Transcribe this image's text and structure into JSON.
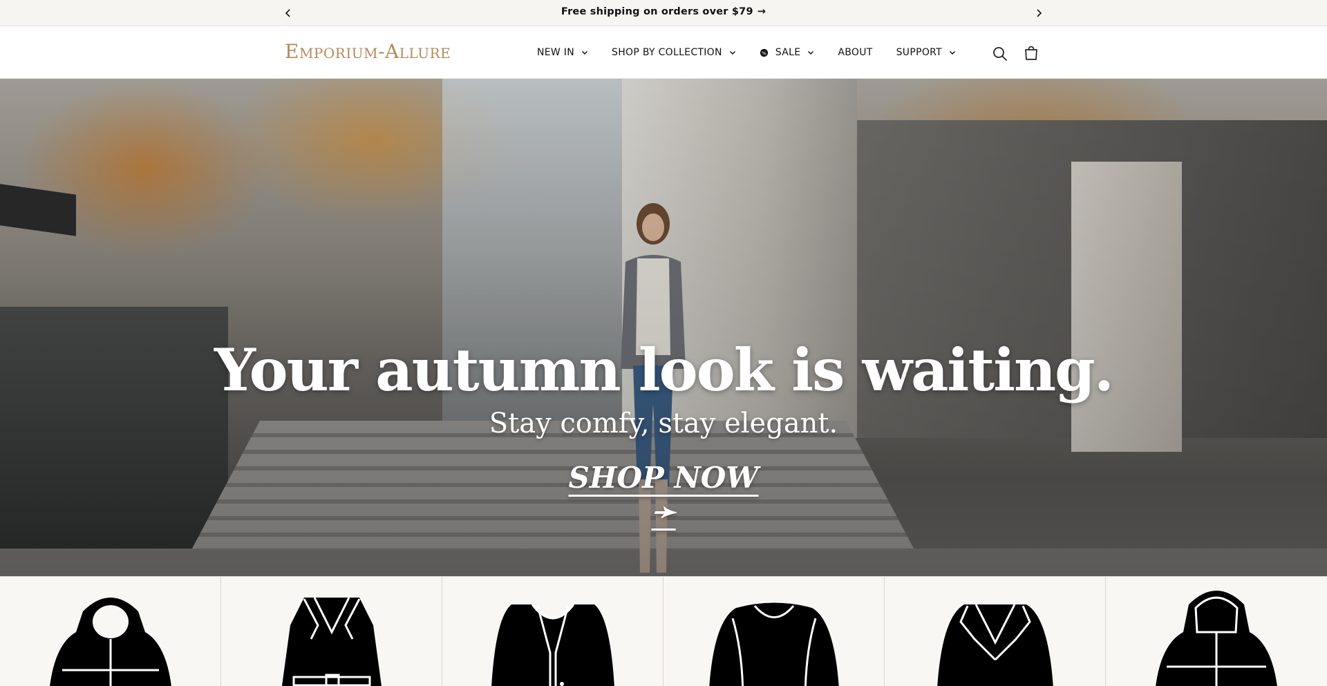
{
  "announcement": {
    "message": "Free shipping on orders over $79",
    "arrow": "→",
    "prev_icon": "chevron-left-icon",
    "next_icon": "chevron-right-icon"
  },
  "header": {
    "logo": "Emporium-Allure",
    "nav": [
      {
        "label": "NEW IN",
        "has_dropdown": true
      },
      {
        "label": "SHOP BY COLLECTION",
        "has_dropdown": true
      },
      {
        "label": "SALE",
        "has_dropdown": true,
        "icon": "sale-tag-icon"
      },
      {
        "label": "ABOUT",
        "has_dropdown": false
      },
      {
        "label": "SUPPORT",
        "has_dropdown": true
      }
    ],
    "icons": [
      "search-icon",
      "cart-icon"
    ]
  },
  "hero": {
    "title": "Your autumn look is waiting.",
    "subtitle": "Stay comfy, stay elegant.",
    "cta": "SHOP NOW ➛"
  },
  "collections": {
    "items": [
      {
        "icon": "puffer-jacket-icon"
      },
      {
        "icon": "trench-coat-icon"
      },
      {
        "icon": "cardigan-icon"
      },
      {
        "icon": "sweater-icon"
      },
      {
        "icon": "blazer-icon"
      },
      {
        "icon": "hooded-puffer-icon"
      }
    ]
  },
  "colors": {
    "logo": "#b48a5a",
    "announcement_bg": "#f7f5f1",
    "grid_bg": "#f8f7f3"
  }
}
